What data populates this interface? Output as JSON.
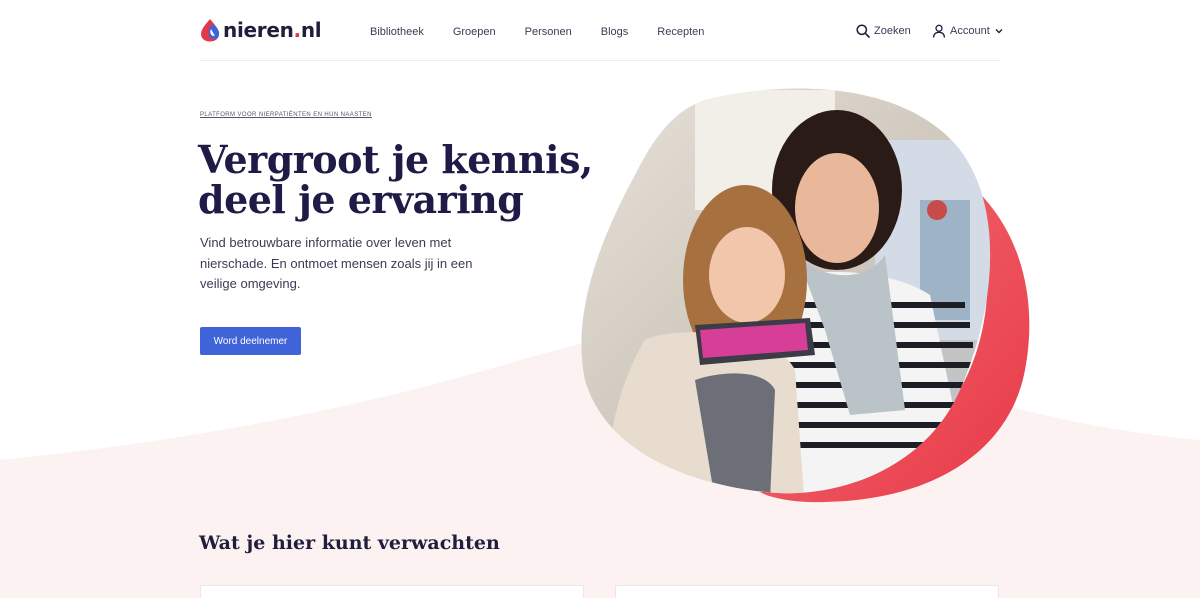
{
  "brand": {
    "name": "nieren",
    "tld_dot": ".",
    "tld": "nl",
    "colors": {
      "navy": "#1e1b47",
      "red": "#e3374a",
      "blue": "#3f63d9",
      "blush": "#fdf1f1"
    }
  },
  "nav": {
    "items": [
      {
        "label": "Bibliotheek"
      },
      {
        "label": "Groepen"
      },
      {
        "label": "Personen"
      },
      {
        "label": "Blogs"
      },
      {
        "label": "Recepten"
      }
    ],
    "search_label": "Zoeken",
    "account_label": "Account"
  },
  "hero": {
    "eyebrow": "PLATFORM VOOR NIERPATIËNTEN EN HUN NAASTEN",
    "title": "Vergroot je kennis, deel je ervaring",
    "text": "Vind betrouwbare informatie over leven met nierschade. En ontmoet mensen zoals jij in een veilige omgeving.",
    "cta_label": "Word deelnemer"
  },
  "section": {
    "title": "Wat je hier kunt verwachten"
  },
  "icons": [
    "logo-drop-icon",
    "search-icon",
    "user-icon",
    "chevron-down-icon"
  ]
}
